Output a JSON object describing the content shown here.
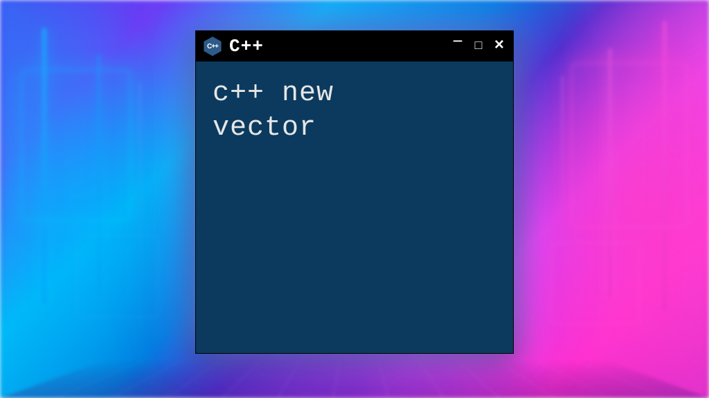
{
  "window": {
    "title": "C++",
    "icon_label": "C++",
    "controls": {
      "minimize": "−",
      "maximize": "□",
      "close": "×"
    }
  },
  "content": {
    "text": "c++ new\nvector"
  },
  "colors": {
    "window_bg": "#0b3a5e",
    "titlebar_bg": "#000000",
    "text": "#e6e6e6",
    "icon_hex": "#2d5b8a"
  }
}
